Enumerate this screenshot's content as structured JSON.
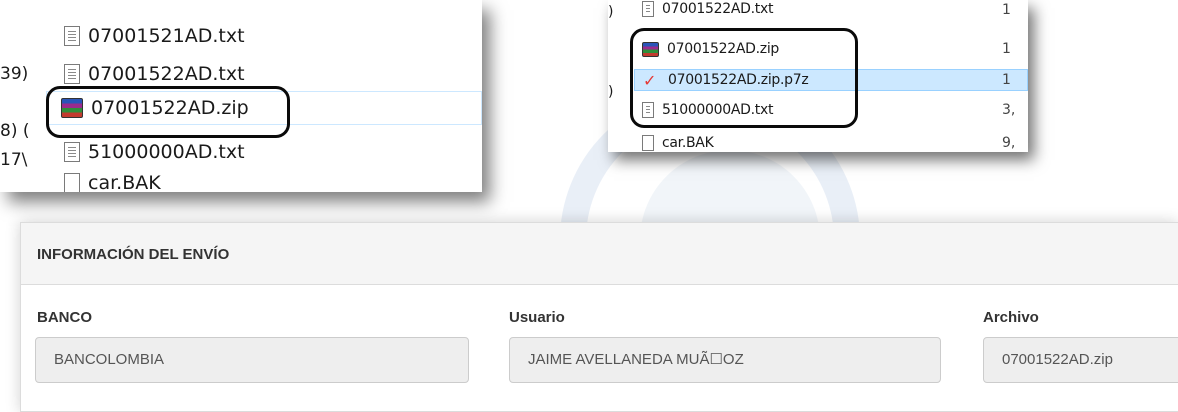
{
  "explorer_left": {
    "side_text": [
      "39)",
      "8) (",
      "17\\"
    ],
    "files": [
      {
        "name": "07001521AD.txt",
        "icon": "text-file-icon"
      },
      {
        "name": "07001522AD.txt",
        "icon": "text-file-icon"
      },
      {
        "name": "07001522AD.zip",
        "icon": "winrar-archive-icon",
        "selected": true
      },
      {
        "name": "51000000AD.txt",
        "icon": "text-file-icon"
      },
      {
        "name": "car.BAK",
        "icon": "document-icon"
      }
    ]
  },
  "explorer_right": {
    "side_text": [
      ")",
      ")"
    ],
    "files": [
      {
        "name": "07001522AD.txt",
        "icon": "text-file-icon",
        "size": "1"
      },
      {
        "name": "07001522AD.zip",
        "icon": "winrar-archive-icon",
        "size": "1"
      },
      {
        "name": "07001522AD.zip.p7z",
        "icon": "signed-file-check-icon",
        "size": "1",
        "selected": true
      },
      {
        "name": "51000000AD.txt",
        "icon": "text-file-icon",
        "size": "3,"
      },
      {
        "name": "car.BAK",
        "icon": "document-icon",
        "size": "9,"
      }
    ]
  },
  "shipment_panel": {
    "title": "INFORMACIÓN DEL ENVÍO",
    "fields": [
      {
        "label": "BANCO",
        "value": "BANCOLOMBIA"
      },
      {
        "label": "Usuario",
        "value": "JAIME AVELLANEDA MUÃ☐OZ"
      },
      {
        "label": "Archivo",
        "value": "07001522AD.zip"
      }
    ]
  },
  "colors": {
    "selection_blue": "#cce8ff",
    "callout_border": "#0a0a0a",
    "panel_header_bg": "#f5f5f5",
    "input_bg": "#eeeeee"
  }
}
